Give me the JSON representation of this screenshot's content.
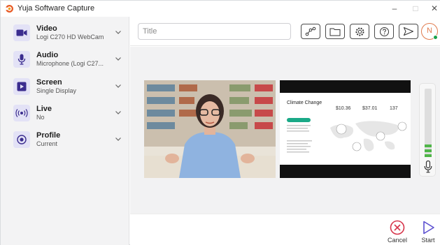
{
  "window": {
    "title": "Yuja Software Capture",
    "min_glyph": "–",
    "max_glyph": "□",
    "close_glyph": "✕"
  },
  "sidebar": {
    "items": [
      {
        "label": "Video",
        "sub": "Logi C270 HD WebCam",
        "icon": "webcam-icon"
      },
      {
        "label": "Audio",
        "sub": "Microphone (Logi C27...",
        "icon": "microphone-icon"
      },
      {
        "label": "Screen",
        "sub": "Single Display",
        "icon": "screen-icon"
      },
      {
        "label": "Live",
        "sub": "No",
        "icon": "broadcast-icon"
      },
      {
        "label": "Profile",
        "sub": "Current",
        "icon": "profile-icon"
      }
    ]
  },
  "toolbar": {
    "title_placeholder": "Title",
    "buttons": [
      "share-icon",
      "folder-icon",
      "settings-gear-icon",
      "help-icon",
      "send-icon"
    ],
    "avatar_initial": "N"
  },
  "preview": {
    "slide": {
      "title": "Climate Change",
      "stats": [
        {
          "value": "$10.36"
        },
        {
          "value": "$37.01"
        },
        {
          "value": "137"
        }
      ]
    },
    "audio_level": 0.22
  },
  "actions": {
    "cancel_label": "Cancel",
    "start_label": "Start"
  },
  "colors": {
    "accent": "#e3e2f6",
    "icon_purple": "#3b2d8f",
    "cancel_red": "#d6344a",
    "start_purple": "#5b4fd0",
    "meter_green": "#4fb548"
  }
}
